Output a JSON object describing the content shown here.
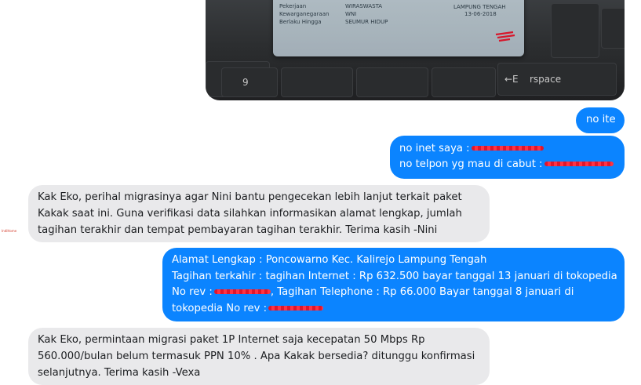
{
  "photo": {
    "card_fields": [
      {
        "label": "Pekerjaan",
        "value": "WIRASWASTA"
      },
      {
        "label": "Kewarganegaraan",
        "value": "WNI"
      },
      {
        "label": "Berlaku Hingga",
        "value": "SEUMUR HIDUP"
      }
    ],
    "card_region": "LAMPUNG TENGAH",
    "card_date": "13-06-2018",
    "key_9": "9",
    "key_backspace": "←E",
    "key_space": "rspace"
  },
  "messages": [
    {
      "lines": [
        "no ite"
      ]
    },
    {
      "lines": [
        "no inet saya :",
        "no telpon yg mau di cabut :"
      ]
    },
    {
      "avatar": "IndiHome",
      "lines": [
        "Kak Eko, perihal migrasinya agar Nini bantu pengecekan lebih lanjut terkait paket",
        "Kakak saat ini. Guna verifikasi data silahkan informasikan alamat lengkap, jumlah",
        "tagihan terakhir dan tempat pembayaran tagihan terakhir. Terima kasih -Nini"
      ]
    },
    {
      "lines": [
        "Alamat Lengkap : Poncowarno Kec. Kalirejo Lampung Tengah",
        "Tagihan terkahir : tagihan Internet : Rp 632.500 bayar tanggal 13 januari di tokopedia",
        "No rev :",
        ", Tagihan Telephone : Rp 66.000 Bayar tanggal 8 januari di",
        "tokopedia No rev :"
      ]
    },
    {
      "lines": [
        "Kak Eko, permintaan migrasi paket 1P Internet saja kecepatan 50 Mbps Rp",
        "560.000/bulan belum termasuk PPN 10% . Apa Kakak bersedia? ditunggu konfirmasi",
        "selanjutnya. Terima kasih -Vexa"
      ]
    }
  ],
  "colors": {
    "outgoing_bubble": "#0b84ff",
    "incoming_bubble": "#e9e9eb",
    "redaction": "#e0162b"
  }
}
